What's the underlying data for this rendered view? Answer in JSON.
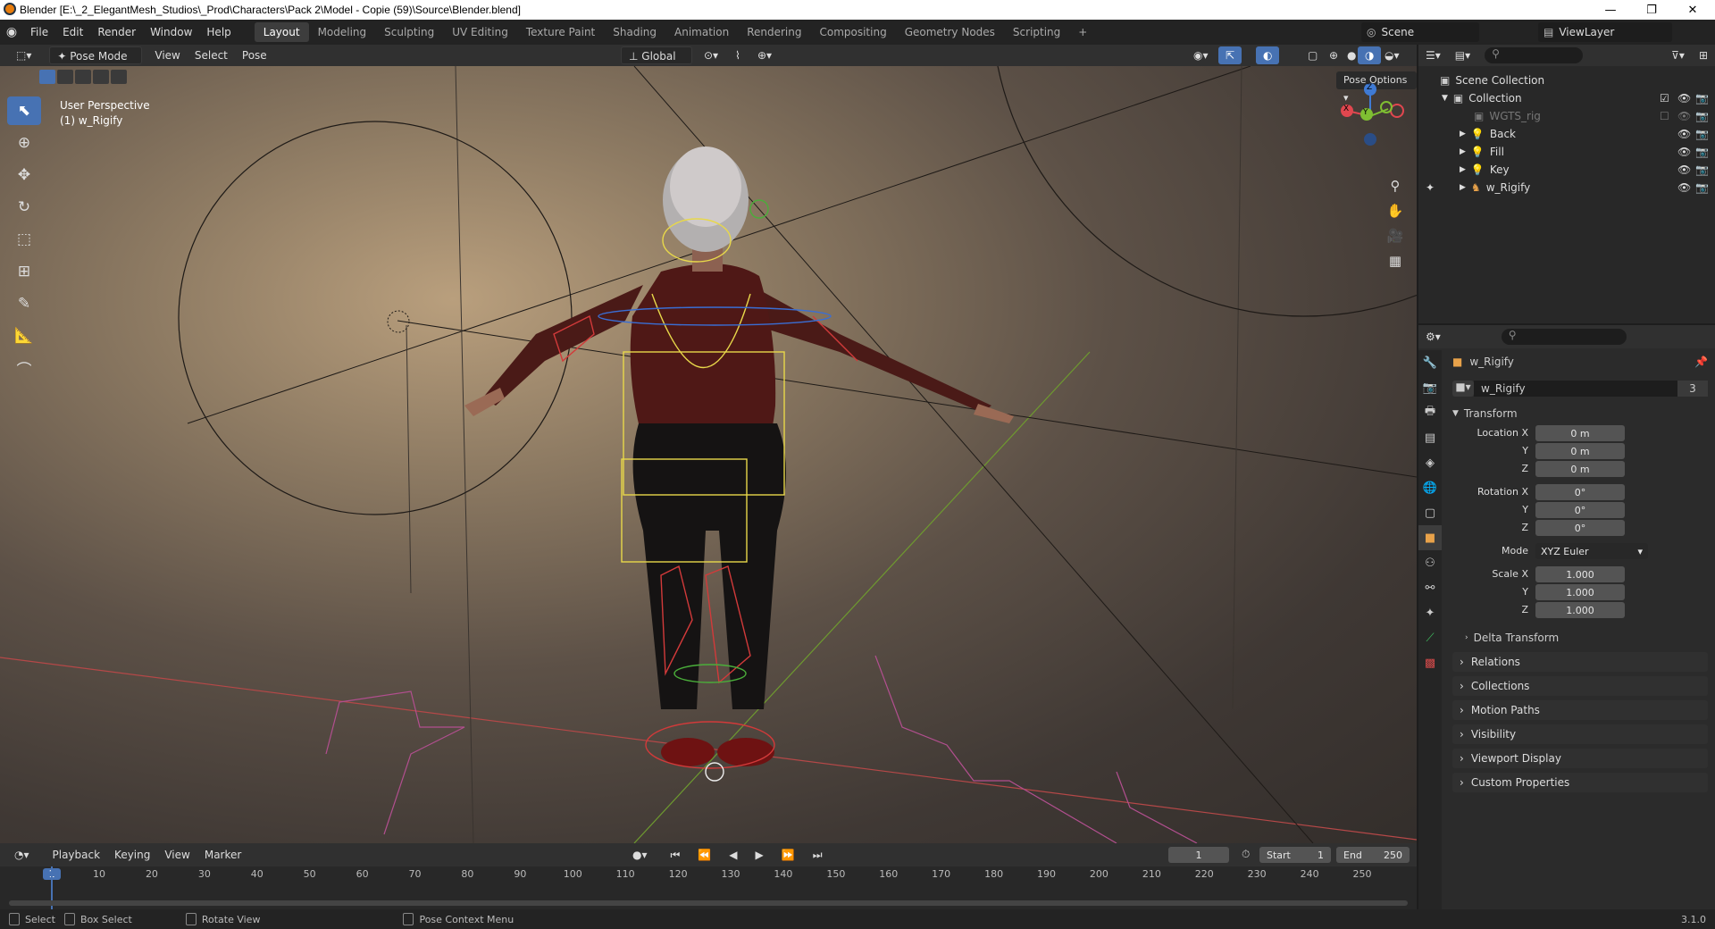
{
  "window": {
    "title": "Blender [E:\\_2_ElegantMesh_Studios\\_Prod\\Characters\\Pack 2\\Model - Copie (59)\\Source\\Blender.blend]",
    "minimize": "—",
    "maximize": "❐",
    "close": "✕"
  },
  "menubar": {
    "items": [
      "File",
      "Edit",
      "Render",
      "Window",
      "Help"
    ]
  },
  "workspaces": [
    "Layout",
    "Modeling",
    "Sculpting",
    "UV Editing",
    "Texture Paint",
    "Shading",
    "Animation",
    "Rendering",
    "Compositing",
    "Geometry Nodes",
    "Scripting",
    "+"
  ],
  "scene": {
    "label": "Scene"
  },
  "viewlayer": {
    "label": "ViewLayer"
  },
  "viewport_header": {
    "mode": "Pose Mode",
    "menus": [
      "View",
      "Select",
      "Pose"
    ],
    "orientation": "Global",
    "pose_options": "Pose Options"
  },
  "viewport": {
    "perspective": "User Perspective",
    "object": "(1) w_Rigify",
    "gizmo": {
      "x": "X",
      "y": "Y",
      "z": "Z"
    }
  },
  "outliner": {
    "scene_collection": "Scene Collection",
    "collection": "Collection",
    "items": [
      "WGTS_rig",
      "Back",
      "Fill",
      "Key",
      "w_Rigify"
    ]
  },
  "properties": {
    "object_name": "w_Rigify",
    "datablock": "w_Rigify",
    "users": "3",
    "transform_label": "Transform",
    "location": {
      "label_x": "Location X",
      "x": "0 m",
      "y": "0 m",
      "z": "0 m"
    },
    "rotation": {
      "label_x": "Rotation X",
      "x": "0°",
      "y": "0°",
      "z": "0°"
    },
    "mode": {
      "label": "Mode",
      "value": "XYZ Euler"
    },
    "scale": {
      "label_x": "Scale X",
      "x": "1.000",
      "y": "1.000",
      "z": "1.000"
    },
    "axis_y": "Y",
    "axis_z": "Z",
    "delta": "Delta Transform",
    "panels": [
      "Relations",
      "Collections",
      "Motion Paths",
      "Visibility",
      "Viewport Display",
      "Custom Properties"
    ]
  },
  "timeline": {
    "menus": [
      "Playback",
      "Keying",
      "View",
      "Marker"
    ],
    "current_frame": "1",
    "start_label": "Start",
    "start": "1",
    "end_label": "End",
    "end": "250",
    "ruler": [
      "1",
      "10",
      "20",
      "30",
      "40",
      "50",
      "60",
      "70",
      "80",
      "90",
      "100",
      "110",
      "120",
      "130",
      "140",
      "150",
      "160",
      "170",
      "180",
      "190",
      "200",
      "210",
      "220",
      "230",
      "240",
      "250"
    ]
  },
  "statusbar": {
    "select": "Select",
    "box_select": "Box Select",
    "rotate_view": "Rotate View",
    "context_menu": "Pose Context Menu",
    "version": "3.1.0"
  },
  "colors": {
    "accent": "#4772b3",
    "x_axis": "#e0474f",
    "y_axis": "#7fbe32",
    "z_axis": "#3f7ad4",
    "bone_yellow": "#e8d84a"
  }
}
